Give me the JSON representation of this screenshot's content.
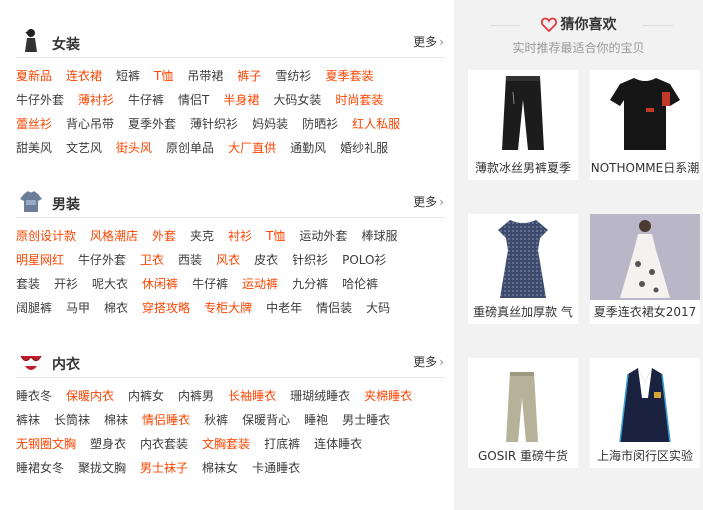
{
  "categories": [
    {
      "title": "女装",
      "icon": "woman-figure-icon",
      "more_label": "更多",
      "rows": [
        [
          {
            "t": "夏新品",
            "hot": true
          },
          {
            "t": "连衣裙",
            "hot": true
          },
          {
            "t": "短裤",
            "hot": false
          },
          {
            "t": "T恤",
            "hot": true
          },
          {
            "t": "吊带裙",
            "hot": false
          },
          {
            "t": "裤子",
            "hot": true
          },
          {
            "t": "雪纺衫",
            "hot": false
          },
          {
            "t": "夏季套装",
            "hot": true
          }
        ],
        [
          {
            "t": "牛仔外套",
            "hot": false
          },
          {
            "t": "薄衬衫",
            "hot": true
          },
          {
            "t": "牛仔裤",
            "hot": false
          },
          {
            "t": "情侣T",
            "hot": false
          },
          {
            "t": "半身裙",
            "hot": true
          },
          {
            "t": "大码女装",
            "hot": false
          },
          {
            "t": "时尚套装",
            "hot": true
          }
        ],
        [
          {
            "t": "蕾丝衫",
            "hot": true
          },
          {
            "t": "背心吊带",
            "hot": false
          },
          {
            "t": "夏季外套",
            "hot": false
          },
          {
            "t": "薄针织衫",
            "hot": false
          },
          {
            "t": "妈妈装",
            "hot": false
          },
          {
            "t": "防晒衫",
            "hot": false
          },
          {
            "t": "红人私服",
            "hot": true
          }
        ],
        [
          {
            "t": "甜美风",
            "hot": false
          },
          {
            "t": "文艺风",
            "hot": false
          },
          {
            "t": "街头风",
            "hot": true
          },
          {
            "t": "原创单品",
            "hot": false
          },
          {
            "t": "大厂直供",
            "hot": true
          },
          {
            "t": "通勤风",
            "hot": false
          },
          {
            "t": "婚纱礼服",
            "hot": false
          }
        ]
      ]
    },
    {
      "title": "男装",
      "icon": "tshirt-icon",
      "more_label": "更多",
      "rows": [
        [
          {
            "t": "原创设计款",
            "hot": true
          },
          {
            "t": "风格潮店",
            "hot": true
          },
          {
            "t": "外套",
            "hot": true
          },
          {
            "t": "夹克",
            "hot": false
          },
          {
            "t": "衬衫",
            "hot": true
          },
          {
            "t": "T恤",
            "hot": true
          },
          {
            "t": "运动外套",
            "hot": false
          },
          {
            "t": "棒球服",
            "hot": false
          }
        ],
        [
          {
            "t": "明星网红",
            "hot": true
          },
          {
            "t": "牛仔外套",
            "hot": false
          },
          {
            "t": "卫衣",
            "hot": true
          },
          {
            "t": "西装",
            "hot": false
          },
          {
            "t": "风衣",
            "hot": true
          },
          {
            "t": "皮衣",
            "hot": false
          },
          {
            "t": "针织衫",
            "hot": false
          },
          {
            "t": "POLO衫",
            "hot": false
          }
        ],
        [
          {
            "t": "套装",
            "hot": false
          },
          {
            "t": "开衫",
            "hot": false
          },
          {
            "t": "呢大衣",
            "hot": false
          },
          {
            "t": "休闲裤",
            "hot": true
          },
          {
            "t": "牛仔裤",
            "hot": false
          },
          {
            "t": "运动裤",
            "hot": true
          },
          {
            "t": "九分裤",
            "hot": false
          },
          {
            "t": "哈伦裤",
            "hot": false
          }
        ],
        [
          {
            "t": "阔腿裤",
            "hot": false
          },
          {
            "t": "马甲",
            "hot": false
          },
          {
            "t": "棉衣",
            "hot": false
          },
          {
            "t": "穿搭攻略",
            "hot": true
          },
          {
            "t": "专柜大牌",
            "hot": true
          },
          {
            "t": "中老年",
            "hot": false
          },
          {
            "t": "情侣装",
            "hot": false
          },
          {
            "t": "大码",
            "hot": false
          }
        ]
      ]
    },
    {
      "title": "内衣",
      "icon": "lingerie-icon",
      "more_label": "更多",
      "rows": [
        [
          {
            "t": "睡衣冬",
            "hot": false
          },
          {
            "t": "保暖内衣",
            "hot": true
          },
          {
            "t": "内裤女",
            "hot": false
          },
          {
            "t": "内裤男",
            "hot": false
          },
          {
            "t": "长袖睡衣",
            "hot": true
          },
          {
            "t": "珊瑚绒睡衣",
            "hot": false
          },
          {
            "t": "夹棉睡衣",
            "hot": true
          }
        ],
        [
          {
            "t": "裤袜",
            "hot": false
          },
          {
            "t": "长筒袜",
            "hot": false
          },
          {
            "t": "棉袜",
            "hot": false
          },
          {
            "t": "情侣睡衣",
            "hot": true
          },
          {
            "t": "秋裤",
            "hot": false
          },
          {
            "t": "保暖背心",
            "hot": false
          },
          {
            "t": "睡袍",
            "hot": false
          },
          {
            "t": "男士睡衣",
            "hot": false
          }
        ],
        [
          {
            "t": "无钢圈文胸",
            "hot": true
          },
          {
            "t": "塑身衣",
            "hot": false
          },
          {
            "t": "内衣套装",
            "hot": false
          },
          {
            "t": "文胸套装",
            "hot": true
          },
          {
            "t": "打底裤",
            "hot": false
          },
          {
            "t": "连体睡衣",
            "hot": false
          }
        ],
        [
          {
            "t": "睡裙女冬",
            "hot": false
          },
          {
            "t": "聚拢文胸",
            "hot": false
          },
          {
            "t": "男士袜子",
            "hot": true
          },
          {
            "t": "棉袜女",
            "hot": false
          },
          {
            "t": "卡通睡衣",
            "hot": false
          }
        ]
      ]
    }
  ],
  "guess": {
    "title": "猜你喜欢",
    "subtitle": "实时推荐最适合你的宝贝",
    "products": [
      {
        "caption": "薄款冰丝男裤夏季",
        "icon": "black-pants-icon"
      },
      {
        "caption": "NOTHOMME日系潮",
        "icon": "black-tshirt-icon"
      },
      {
        "caption": "重磅真丝加厚款 气",
        "icon": "navy-dress-icon"
      },
      {
        "caption": "夏季连衣裙女2017",
        "icon": "floral-dress-icon"
      },
      {
        "caption": "GOSIR 重磅牛货",
        "icon": "khaki-pants-icon"
      },
      {
        "caption": "上海市闵行区实验",
        "icon": "school-blazer-icon"
      }
    ]
  },
  "colors": {
    "hot": "#ff4400",
    "accent_heart": "#e4393c",
    "right_bg": "#f2f2f2"
  }
}
